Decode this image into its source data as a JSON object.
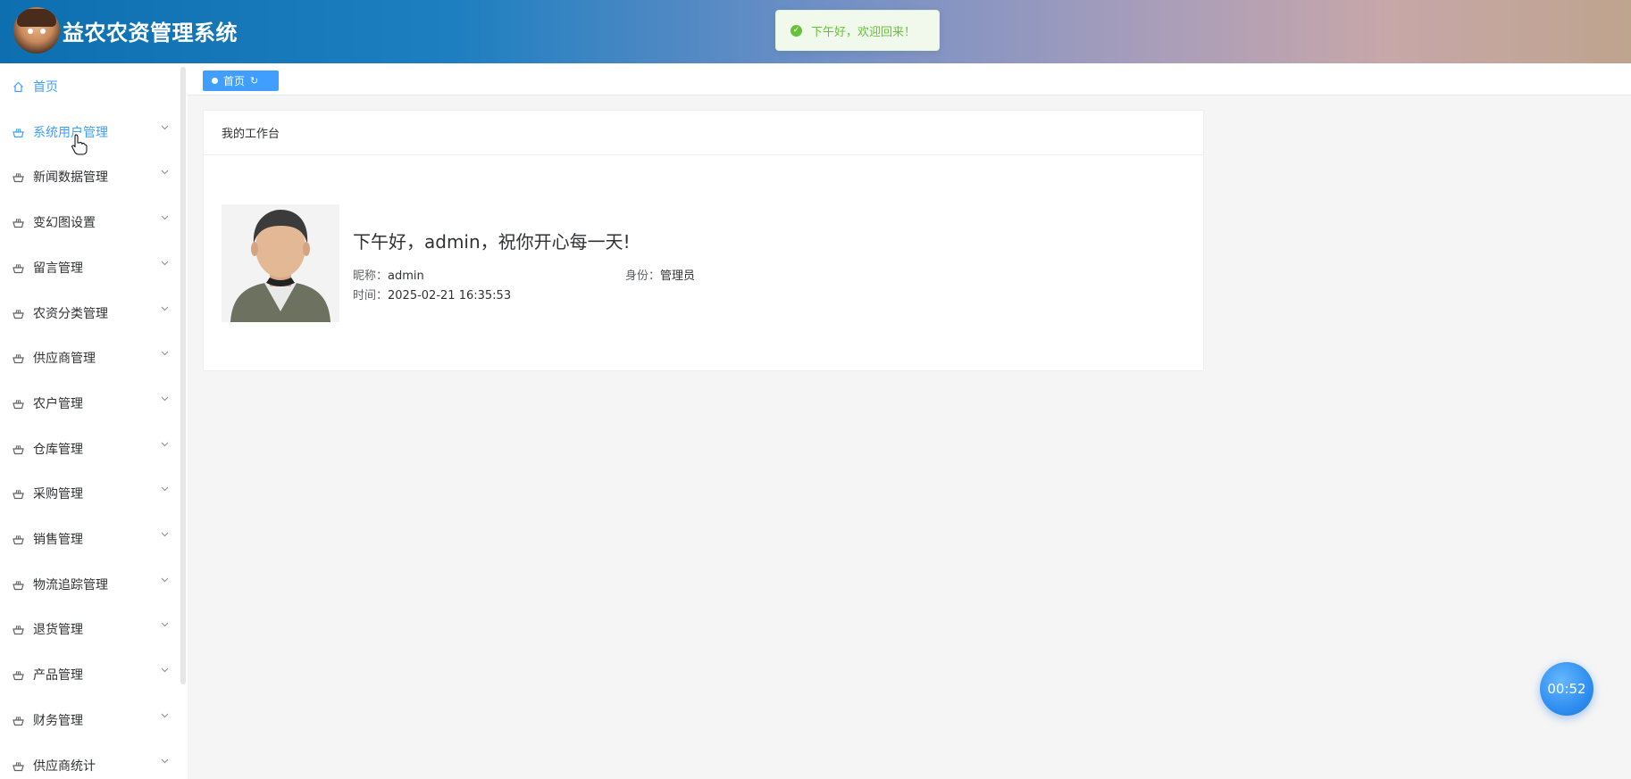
{
  "header": {
    "title": "益农农资管理系统",
    "logo_icon": "cartoon-avatar-logo"
  },
  "toast": {
    "message": "下午好，欢迎回来！",
    "type": "success",
    "color": "#67c23a"
  },
  "sidebar": {
    "items": [
      {
        "label": "首页",
        "icon": "home-icon",
        "active": true,
        "has_children": false
      },
      {
        "label": "系统用户管理",
        "icon": "basket-icon",
        "active": true,
        "has_children": true
      },
      {
        "label": "新闻数据管理",
        "icon": "basket-icon",
        "has_children": true
      },
      {
        "label": "变幻图设置",
        "icon": "basket-icon",
        "has_children": true
      },
      {
        "label": "留言管理",
        "icon": "basket-icon",
        "has_children": true
      },
      {
        "label": "农资分类管理",
        "icon": "basket-icon",
        "has_children": true
      },
      {
        "label": "供应商管理",
        "icon": "basket-icon",
        "has_children": true
      },
      {
        "label": "农户管理",
        "icon": "basket-icon",
        "has_children": true
      },
      {
        "label": "仓库管理",
        "icon": "basket-icon",
        "has_children": true
      },
      {
        "label": "采购管理",
        "icon": "basket-icon",
        "has_children": true
      },
      {
        "label": "销售管理",
        "icon": "basket-icon",
        "has_children": true
      },
      {
        "label": "物流追踪管理",
        "icon": "basket-icon",
        "has_children": true
      },
      {
        "label": "退货管理",
        "icon": "basket-icon",
        "has_children": true
      },
      {
        "label": "产品管理",
        "icon": "basket-icon",
        "has_children": true
      },
      {
        "label": "财务管理",
        "icon": "basket-icon",
        "has_children": true
      },
      {
        "label": "供应商统计",
        "icon": "basket-icon",
        "has_children": true
      }
    ]
  },
  "tabs": [
    {
      "label": "首页",
      "active": true
    }
  ],
  "workbench": {
    "title": "我的工作台",
    "greeting": "下午好，admin，祝你开心每一天!",
    "nickname_label": "昵称：",
    "nickname": "admin",
    "role_label": "身份：",
    "role": "管理员",
    "time_label": "时间：",
    "time": "2025-02-21 16:35:53"
  },
  "timer": {
    "value": "00:52"
  },
  "colors": {
    "accent": "#409eff",
    "success": "#67c23a"
  }
}
